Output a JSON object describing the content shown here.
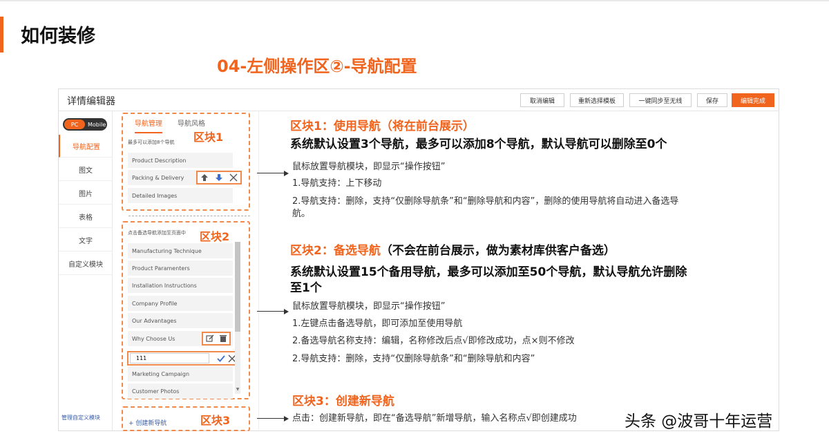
{
  "slide": {
    "title": "如何装修",
    "section_title": "04-左侧操作区②-导航配置"
  },
  "editor": {
    "title": "详情编辑器",
    "buttons": [
      "取消编辑",
      "重新选择模板",
      "一键同步至无线",
      "保存",
      "编辑完成"
    ],
    "toggle": {
      "pc": "PC",
      "mobile": "Mobile"
    },
    "left_nav": [
      "导航配置",
      "图文",
      "图片",
      "表格",
      "文字",
      "自定义模块"
    ],
    "left_footer": "管理自定义模块",
    "tabs": [
      "导航管理",
      "导航风格"
    ],
    "used_hint": "最多可以添加8个导航",
    "used_navs": [
      "Product Description",
      "Packing & Delivery",
      "Detailed Images"
    ],
    "alt_hint": "点击备选导航添加至页面中",
    "alt_navs": [
      "Manufacturing Technique",
      "Product Paramenters",
      "Installation Instructions",
      "Company Profile",
      "Our Advantages",
      "Why Choose Us"
    ],
    "alt_navs_after": [
      "Marketing Campaign",
      "Customer Photos"
    ],
    "edit_value": "111",
    "create_link": "+ 创建新导航",
    "block_labels": [
      "区块1",
      "区块2",
      "区块3"
    ]
  },
  "content": {
    "block1": {
      "heading_orange": "区块1：使用导航",
      "heading_paren": "（将在前台展示）",
      "subheading": "系统默认设置3个导航，最多可以添加8个导航，默认导航可以删除至0个",
      "lines": [
        "鼠标放置导航模块，即显示“操作按钮”",
        "1.导航支持：上下移动",
        "2.导航支持：删除，支持“仅删除导航条”和“删除导航和内容”，删除的使用导航将自动进入备选导",
        "航。"
      ]
    },
    "block2": {
      "heading_orange": "区块2：备选导航",
      "heading_paren": "（不会在前台展示，做为素材库供客户备选）",
      "subheading_1": "系统默认设置15个备用导航，最多可以添加至50个导航，默认导航允许删除",
      "subheading_2": "至1个",
      "lines": [
        "鼠标放置导航模块，即显示“操作按钮”",
        "1.左键点击备选导航，即可添加至使用导航",
        "2.备选导航名称支持：编辑，名称修改后点√即修改成功，点×则不修改",
        "2.导航支持：删除，支持“仅删除导航条”和“删除导航和内容”"
      ]
    },
    "block3": {
      "heading_orange": "区块3：创建新导航",
      "line": "点击：创建新导航，即在“备选导航”新增导航，输入名称点√即创建成功"
    }
  },
  "watermark": "头条 @波哥十年运营"
}
